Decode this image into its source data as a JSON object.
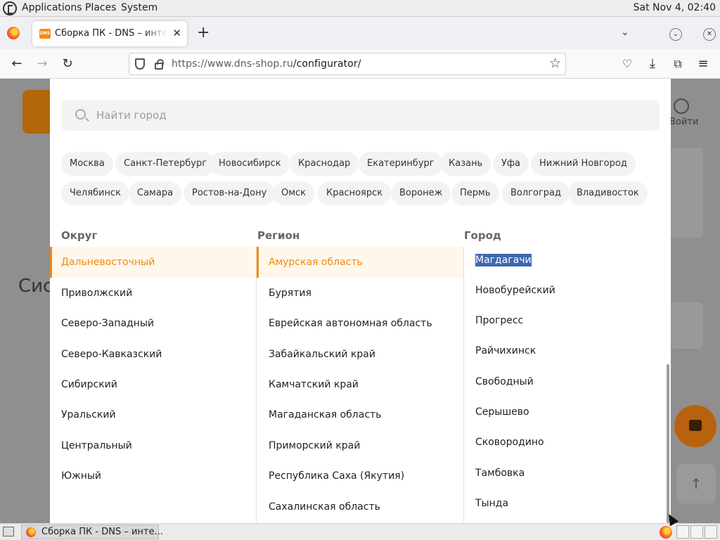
{
  "topbar": {
    "menus": [
      "Applications",
      "Places",
      "System"
    ],
    "clock": "Sat Nov  4, 02:40"
  },
  "browser": {
    "tab_title": "Сборка ПК - DNS – интернет магазин",
    "favicon_text": "DNS",
    "url_host": "https://www.dns-shop.ru",
    "url_path": "/configurator/"
  },
  "site": {
    "login_label": "Войти",
    "heading_fragment": "Сис"
  },
  "modal": {
    "search_placeholder": "Найти город",
    "popular_cities": [
      [
        "Москва",
        "Санкт-Петербург",
        "Новосибирск",
        "Краснодар",
        "Екатеринбург",
        "Казань",
        "Уфа",
        "Нижний Новгород"
      ],
      [
        "Челябинск",
        "Самара",
        "Ростов-на-Дону",
        "Омск",
        "Красноярск",
        "Воронеж",
        "Пермь",
        "Волгоград",
        "Владивосток"
      ]
    ],
    "headers": {
      "district": "Округ",
      "region": "Регион",
      "city": "Город"
    },
    "districts": [
      "Дальневосточный",
      "Приволжский",
      "Северо-Западный",
      "Северо-Кавказский",
      "Сибирский",
      "Уральский",
      "Центральный",
      "Южный"
    ],
    "regions": [
      "Амурская область",
      "Бурятия",
      "Еврейская автономная область",
      "Забайкальский край",
      "Камчатский край",
      "Магаданская область",
      "Приморский край",
      "Республика Саха (Якутия)",
      "Сахалинская область"
    ],
    "cities": [
      "Магдагачи",
      "Новобурейский",
      "Прогресс",
      "Райчихинск",
      "Свободный",
      "Серышево",
      "Сковородино",
      "Тамбовка",
      "Тында"
    ],
    "selected_district": "Дальневосточный",
    "selected_region": "Амурская область",
    "highlighted_city": "Магдагачи"
  },
  "taskbar": {
    "task_label": "Сборка ПК - DNS – инте..."
  },
  "colors": {
    "accent": "#f08a15",
    "active_bg": "#fff7ea",
    "selection": "#3d67b0"
  }
}
